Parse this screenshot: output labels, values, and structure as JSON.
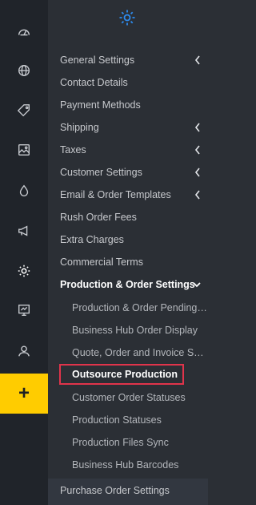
{
  "rail": {
    "icons": [
      {
        "name": "dashboard-icon"
      },
      {
        "name": "globe-icon"
      },
      {
        "name": "tag-icon"
      },
      {
        "name": "image-icon"
      },
      {
        "name": "drop-icon"
      },
      {
        "name": "megaphone-icon"
      },
      {
        "name": "gear-icon"
      },
      {
        "name": "chart-icon"
      },
      {
        "name": "user-icon"
      }
    ],
    "plus_label": "+"
  },
  "colors": {
    "accent": "#2d8cf0",
    "plus_bg": "#ffcc00",
    "highlight_border": "#e0344b"
  },
  "menu": {
    "items": [
      {
        "label": "General Settings",
        "chevron": "left"
      },
      {
        "label": "Contact Details"
      },
      {
        "label": "Payment Methods"
      },
      {
        "label": "Shipping",
        "chevron": "left"
      },
      {
        "label": "Taxes",
        "chevron": "left"
      },
      {
        "label": "Customer Settings",
        "chevron": "left"
      },
      {
        "label": "Email & Order Templates",
        "chevron": "left"
      },
      {
        "label": "Rush Order Fees"
      },
      {
        "label": "Extra Charges"
      },
      {
        "label": "Commercial Terms"
      },
      {
        "label": "Production & Order Settings",
        "chevron": "down",
        "active": true
      }
    ],
    "sub_items": [
      {
        "label": "Production & Order Pending ..."
      },
      {
        "label": "Business Hub Order Display"
      },
      {
        "label": "Quote, Order and Invoice Set..."
      },
      {
        "label": "Outsource Production",
        "highlighted": true
      },
      {
        "label": "Customer Order Statuses"
      },
      {
        "label": "Production Statuses"
      },
      {
        "label": "Production Files Sync"
      },
      {
        "label": "Business Hub Barcodes"
      }
    ],
    "footer_item": {
      "label": "Purchase Order Settings"
    }
  }
}
